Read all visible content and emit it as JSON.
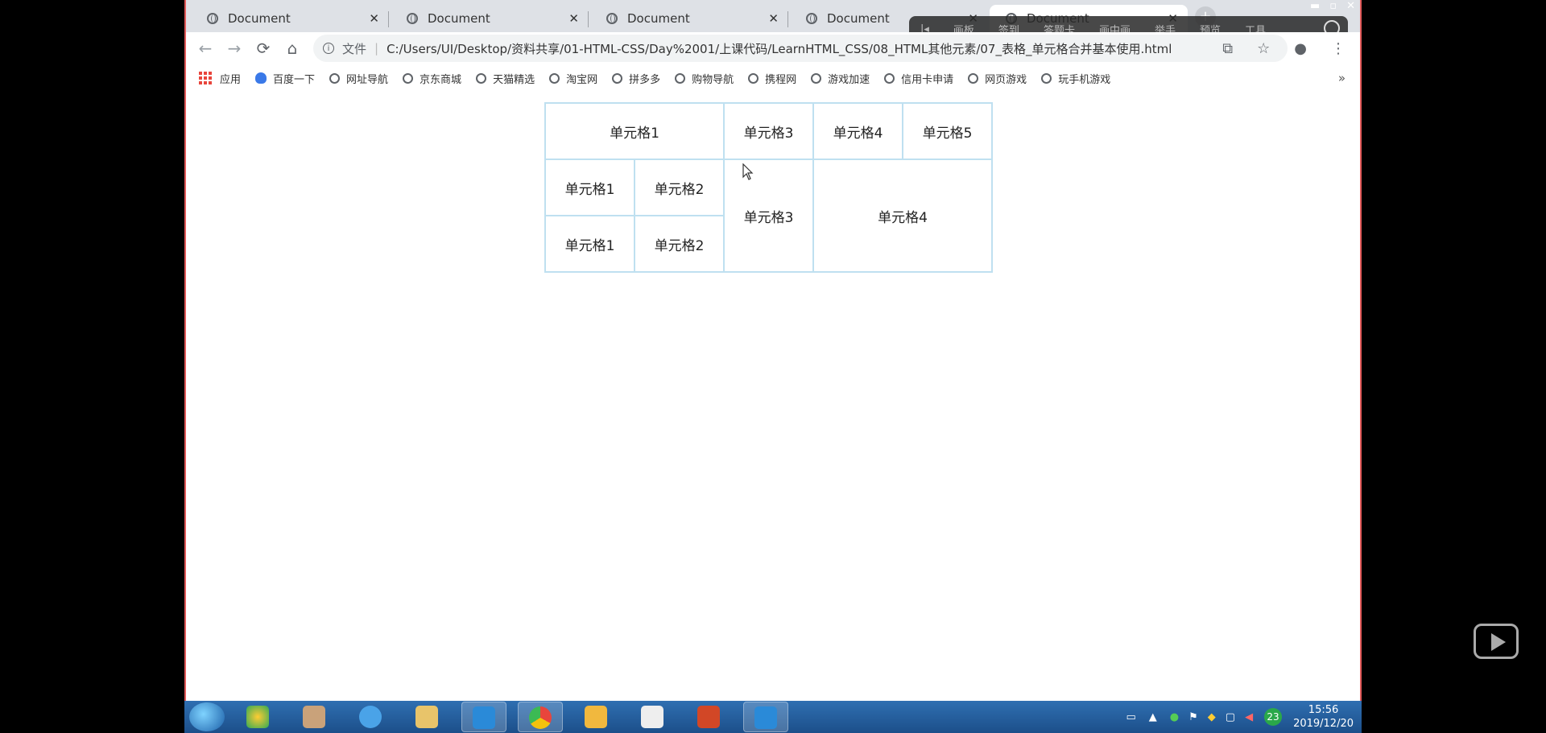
{
  "browser": {
    "tabs": [
      {
        "title": "Document",
        "close": "✕"
      },
      {
        "title": "Document",
        "close": "✕"
      },
      {
        "title": "Document",
        "close": "✕"
      },
      {
        "title": "Document",
        "close": "✕"
      },
      {
        "title": "Document",
        "close": "✕"
      }
    ],
    "new_tab": "+",
    "nav": {
      "back": "←",
      "forward": "→",
      "reload": "⟳",
      "home": "⌂"
    },
    "address": {
      "scheme_label": "文件",
      "url": "C:/Users/UI/Desktop/资料共享/01-HTML-CSS/Day%2001/上课代码/LearnHTML_CSS/08_HTML其他元素/07_表格_单元格合并基本使用.html"
    },
    "bookmarks": [
      "应用",
      "百度一下",
      "网址导航",
      "京东商城",
      "天猫精选",
      "淘宝网",
      "拼多多",
      "购物导航",
      "携程网",
      "游戏加速",
      "信用卡申请",
      "网页游戏",
      "玩手机游戏"
    ],
    "more": "»"
  },
  "recorder_bar": {
    "items": [
      "画板",
      "签到",
      "答题卡",
      "画中画",
      "举手",
      "预览",
      "工具"
    ]
  },
  "table": {
    "r1": {
      "c1": "单元格1",
      "c3": "单元格3",
      "c4": "单元格4",
      "c5": "单元格5"
    },
    "r2": {
      "c1": "单元格1",
      "c2": "单元格2",
      "c3": "单元格3",
      "c4": "单元格4"
    },
    "r3": {
      "c1": "单元格1",
      "c2": "单元格2"
    }
  },
  "taskbar": {
    "tray_badge": "23",
    "time": "15:56",
    "date": "2019/12/20"
  },
  "colors": {
    "table_border": "#bfe0f0",
    "frame": "#e25a5a",
    "taskbar": "#2f6fb2"
  }
}
